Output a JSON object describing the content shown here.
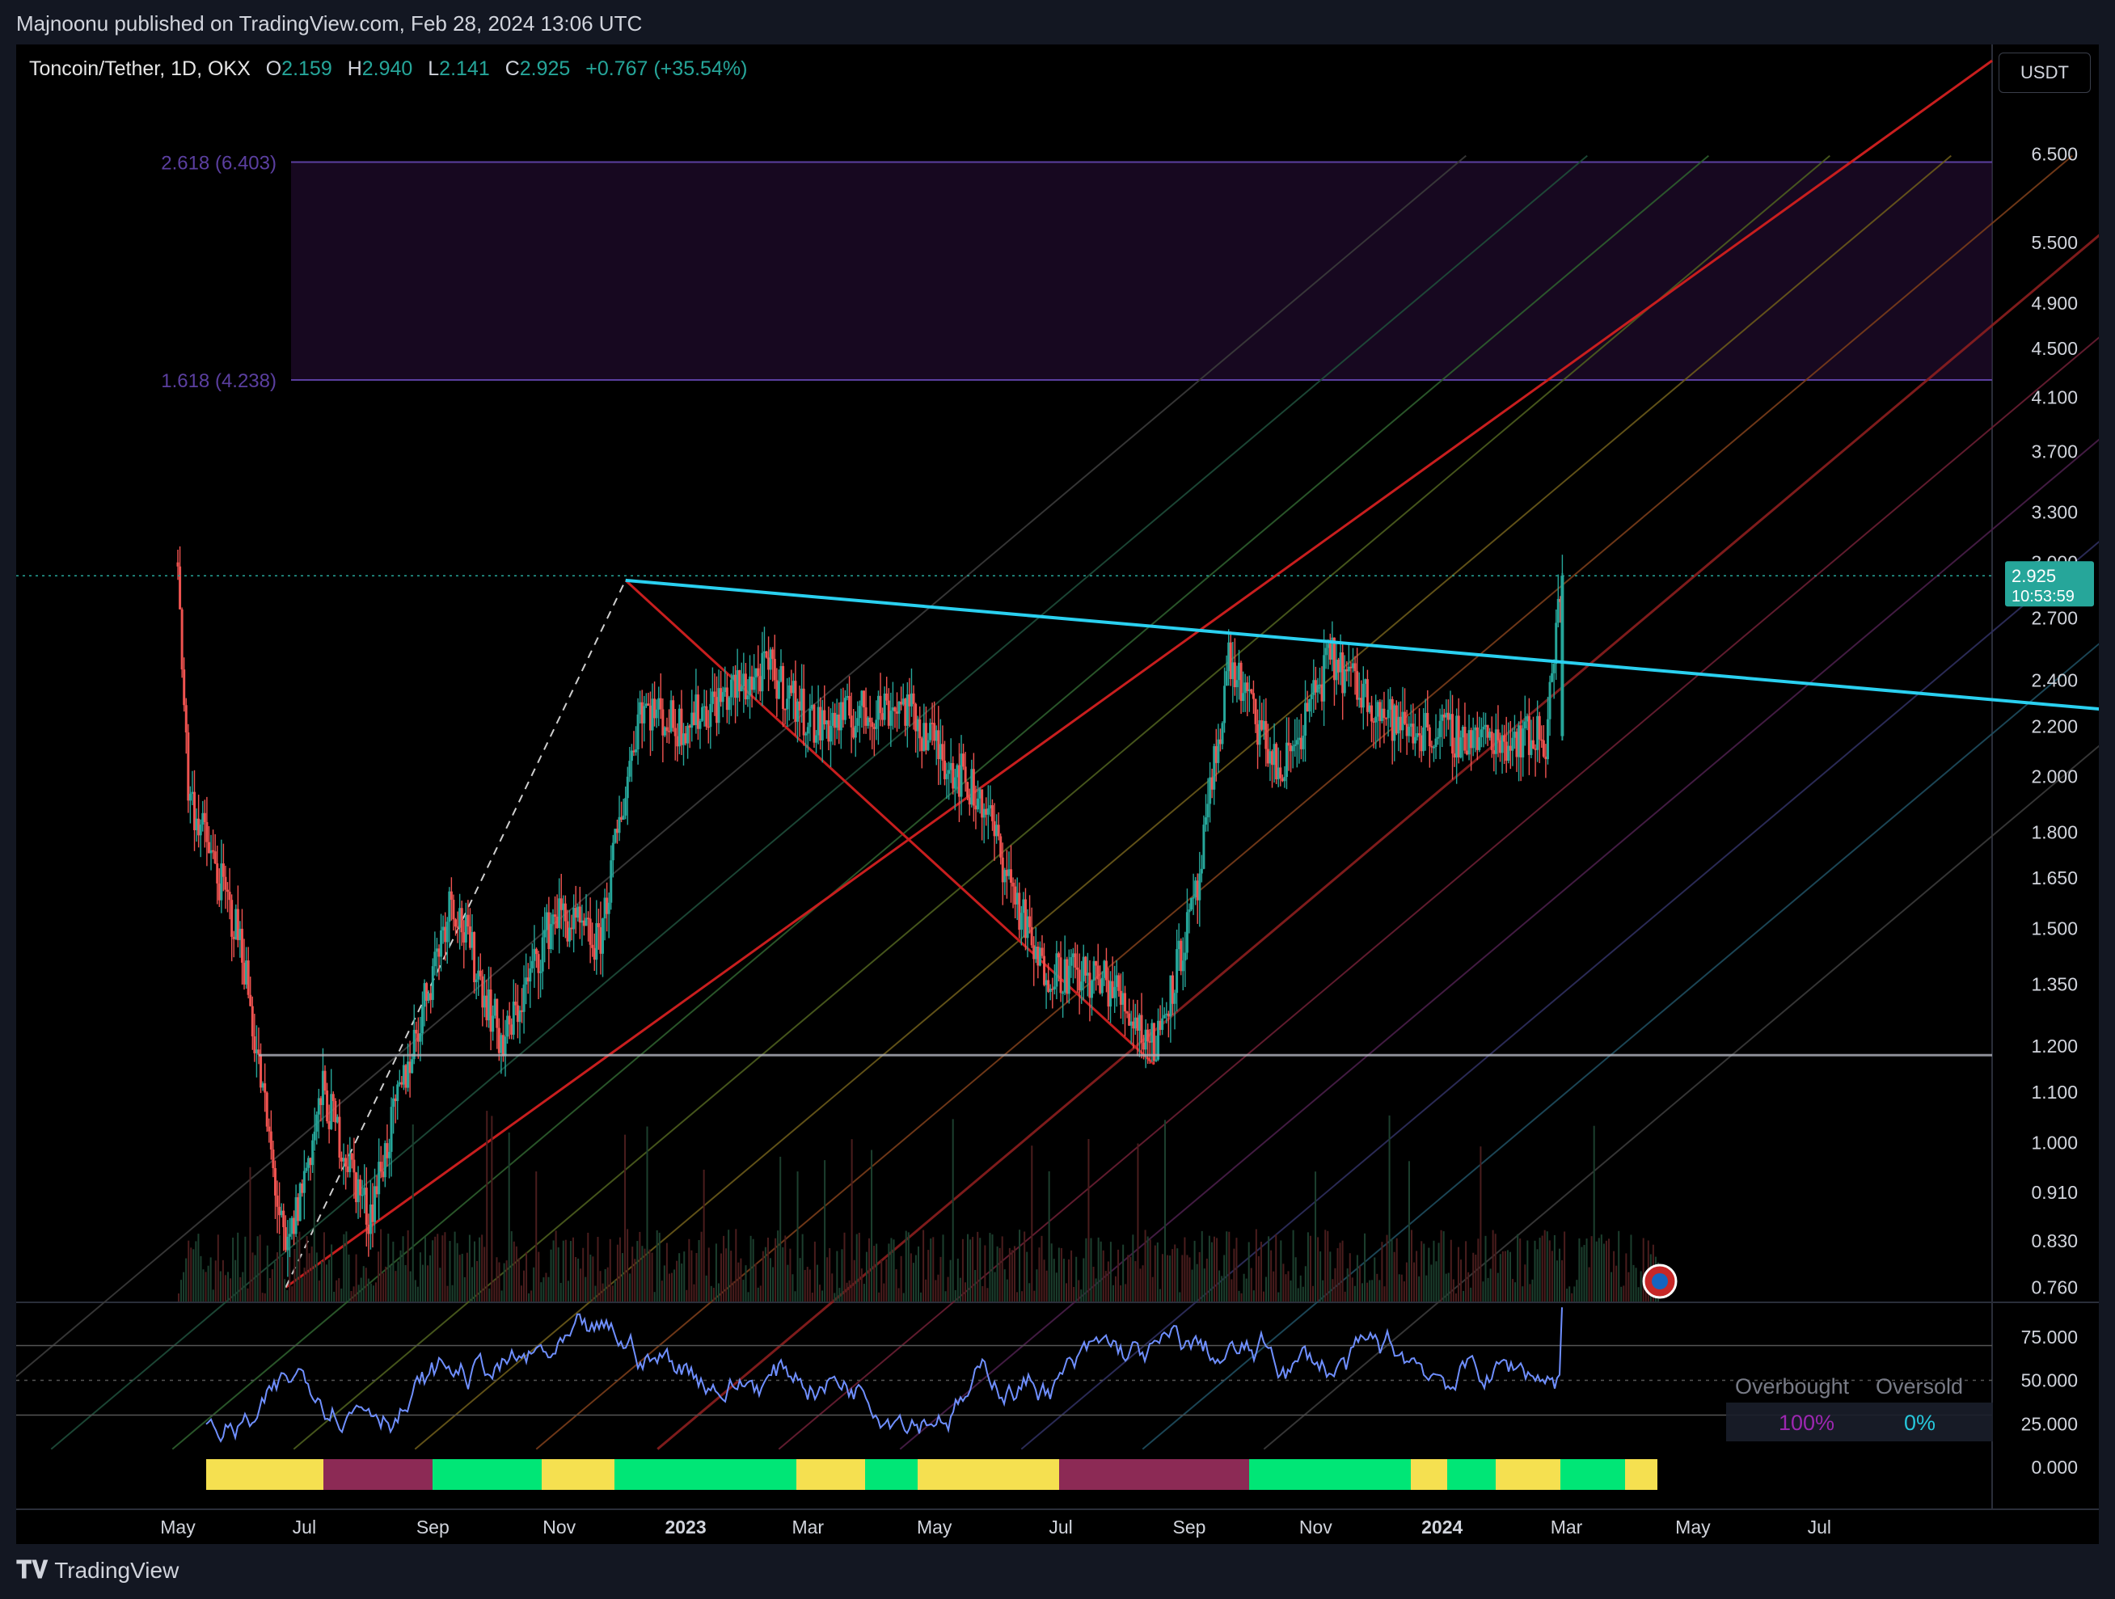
{
  "header": {
    "caption": "Majnoonu published on TradingView.com, Feb 28, 2024 13:06 UTC"
  },
  "legend": {
    "symbol": "Toncoin/Tether, 1D, OKX",
    "open_label": "O",
    "open": "2.159",
    "high_label": "H",
    "high": "2.940",
    "low_label": "L",
    "low": "2.141",
    "close_label": "C",
    "close": "2.925",
    "change": "+0.767 (+35.54%)"
  },
  "currency_button": "USDT",
  "price_tag": {
    "price": "2.925",
    "countdown": "10:53:59"
  },
  "fib_levels": [
    {
      "label": "2.618 (6.403)",
      "price": 6.403
    },
    {
      "label": "1.618 (4.238)",
      "price": 4.238
    }
  ],
  "rsi_panel": {
    "overbought_label": "Overbought",
    "oversold_label": "Oversold",
    "overbought_value": "100%",
    "oversold_value": "0%"
  },
  "footer": {
    "brand": "TradingView"
  },
  "colors": {
    "up": "#26a69a",
    "down": "#ef5350",
    "trendline": "#2ad0f0",
    "fib": "#5b3fa0",
    "rsi": "#6f8fff",
    "background": "#000000"
  },
  "chart_data": [
    {
      "type": "candlestick",
      "symbol": "Toncoin/Tether",
      "interval": "1D",
      "exchange": "OKX",
      "y_scale": "log",
      "ylim": [
        0.74,
        8.0
      ],
      "y_ticks": [
        "6.500",
        "5.500",
        "4.900",
        "4.500",
        "4.100",
        "3.700",
        "3.300",
        "3.000",
        "2.700",
        "2.400",
        "2.200",
        "2.000",
        "1.800",
        "1.650",
        "1.500",
        "1.350",
        "1.200",
        "1.100",
        "1.000",
        "0.910",
        "0.830",
        "0.760"
      ],
      "x_ticks": [
        "May",
        "Jul",
        "Sep",
        "Nov",
        "2023",
        "Mar",
        "May",
        "Jul",
        "Sep",
        "Nov",
        "2024",
        "Mar",
        "May",
        "Jul"
      ],
      "approx_close_path": [
        {
          "date": "2022-05-01",
          "close": 3.0
        },
        {
          "date": "2022-05-06",
          "close": 1.95
        },
        {
          "date": "2022-06-01",
          "close": 1.45
        },
        {
          "date": "2022-06-22",
          "close": 0.8
        },
        {
          "date": "2022-07-10",
          "close": 1.1
        },
        {
          "date": "2022-08-01",
          "close": 0.87
        },
        {
          "date": "2022-08-25",
          "close": 1.25
        },
        {
          "date": "2022-09-10",
          "close": 1.6
        },
        {
          "date": "2022-10-05",
          "close": 1.2
        },
        {
          "date": "2022-10-30",
          "close": 1.55
        },
        {
          "date": "2022-11-20",
          "close": 1.45
        },
        {
          "date": "2022-12-10",
          "close": 2.3
        },
        {
          "date": "2022-12-28",
          "close": 2.2
        },
        {
          "date": "2023-02-10",
          "close": 2.45
        },
        {
          "date": "2023-03-05",
          "close": 2.2
        },
        {
          "date": "2023-04-15",
          "close": 2.3
        },
        {
          "date": "2023-05-25",
          "close": 1.9
        },
        {
          "date": "2023-06-20",
          "close": 1.4
        },
        {
          "date": "2023-07-25",
          "close": 1.35
        },
        {
          "date": "2023-08-15",
          "close": 1.2
        },
        {
          "date": "2023-09-05",
          "close": 1.6
        },
        {
          "date": "2023-09-20",
          "close": 2.5
        },
        {
          "date": "2023-10-15",
          "close": 2.0
        },
        {
          "date": "2023-11-08",
          "close": 2.5
        },
        {
          "date": "2023-12-10",
          "close": 2.2
        },
        {
          "date": "2024-01-20",
          "close": 2.15
        },
        {
          "date": "2024-02-20",
          "close": 2.16
        },
        {
          "date": "2024-02-28",
          "close": 2.925
        }
      ],
      "last": {
        "open": 2.159,
        "high": 2.94,
        "low": 2.141,
        "close": 2.925,
        "change": 0.767,
        "change_pct": 35.54
      },
      "horizontal_support": 1.18,
      "descending_trendline": [
        {
          "date": "2022-12-03",
          "price": 2.9
        },
        {
          "date": "2024-07-05",
          "price": 2.28
        }
      ],
      "fib_extensions": [
        {
          "level": 2.618,
          "price": 6.403
        },
        {
          "level": 1.618,
          "price": 4.238
        }
      ]
    },
    {
      "type": "line",
      "indicator": "RSI",
      "ylim": [
        0,
        100
      ],
      "y_ticks": [
        "75.000",
        "50.000",
        "25.000",
        "0.000"
      ],
      "bands": [
        70,
        50,
        30
      ]
    }
  ]
}
